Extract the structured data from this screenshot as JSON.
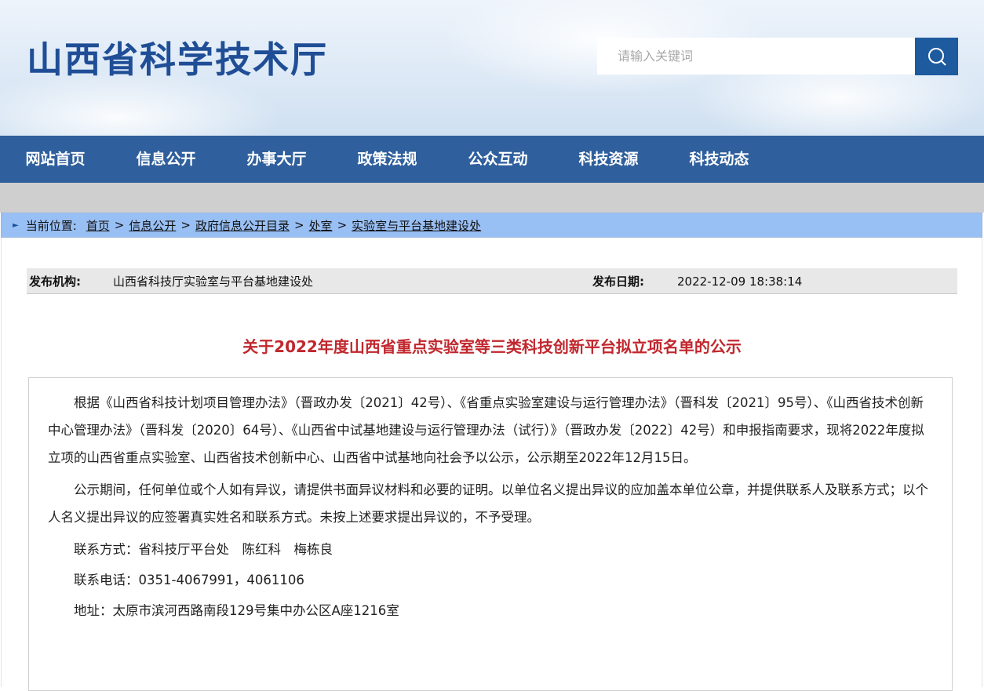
{
  "header": {
    "site_title": "山西省科学技术厅",
    "search_placeholder": "请输入关键词"
  },
  "nav": {
    "items": [
      "网站首页",
      "信息公开",
      "办事大厅",
      "政策法规",
      "公众互动",
      "科技资源",
      "科技动态"
    ]
  },
  "breadcrumb": {
    "label": "当前位置:",
    "items": [
      "首页",
      "信息公开",
      "政府信息公开目录",
      "处室",
      "实验室与平台基地建设处"
    ]
  },
  "meta": {
    "publisher_label": "发布机构:",
    "publisher": "山西省科技厅实验室与平台基地建设处",
    "date_label": "发布日期:",
    "date": "2022-12-09 18:38:14"
  },
  "article": {
    "title": "关于2022年度山西省重点实验室等三类科技创新平台拟立项名单的公示",
    "paragraphs": [
      "根据《山西省科技计划项目管理办法》（晋政办发〔2021〕42号）、《省重点实验室建设与运行管理办法》（晋科发〔2021〕95号）、《山西省技术创新中心管理办法》（晋科发〔2020〕64号）、《山西省中试基地建设与运行管理办法（试行）》（晋政办发〔2022〕42号）和申报指南要求，现将2022年度拟立项的山西省重点实验室、山西省技术创新中心、山西省中试基地向社会予以公示，公示期至2022年12月15日。",
      "公示期间，任何单位或个人如有异议，请提供书面异议材料和必要的证明。以单位名义提出异议的应加盖本单位公章，并提供联系人及联系方式；以个人名义提出异议的应签署真实姓名和联系方式。未按上述要求提出异议的，不予受理。",
      "联系方式：省科技厅平台处　陈红科　梅栋良",
      "联系电话：0351-4067991，4061106",
      "地址：太原市滨河西路南段129号集中办公区A座1216室"
    ]
  },
  "colors": {
    "nav_bg": "#2f5f9c",
    "title_red": "#c1272d",
    "site_title_blue": "#1f4e96",
    "breadcrumb_bg": "#99c0f5"
  }
}
